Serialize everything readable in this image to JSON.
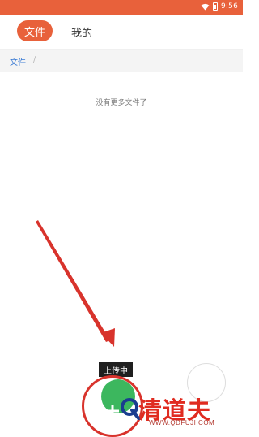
{
  "status_bar": {
    "time": "9:56",
    "wifi_icon": "wifi-icon",
    "battery_icon": "battery-icon",
    "background": "#e8613b"
  },
  "tabs": {
    "files_label": "文件",
    "mine_label": "我的",
    "active": "files",
    "accent": "#e8613b"
  },
  "breadcrumb": {
    "root_label": "文件",
    "separator": "/"
  },
  "content": {
    "empty_message": "没有更多文件了"
  },
  "upload": {
    "tooltip": "上传中",
    "fab_color": "#3cb75e",
    "fab_icon": "plus-icon"
  },
  "annotation": {
    "arrow_color": "#d8332c",
    "highlight_color": "#d8332c"
  },
  "watermark": {
    "text": "清道夫",
    "url": "WWW.QDFUJI.COM",
    "color": "#e02b20"
  }
}
